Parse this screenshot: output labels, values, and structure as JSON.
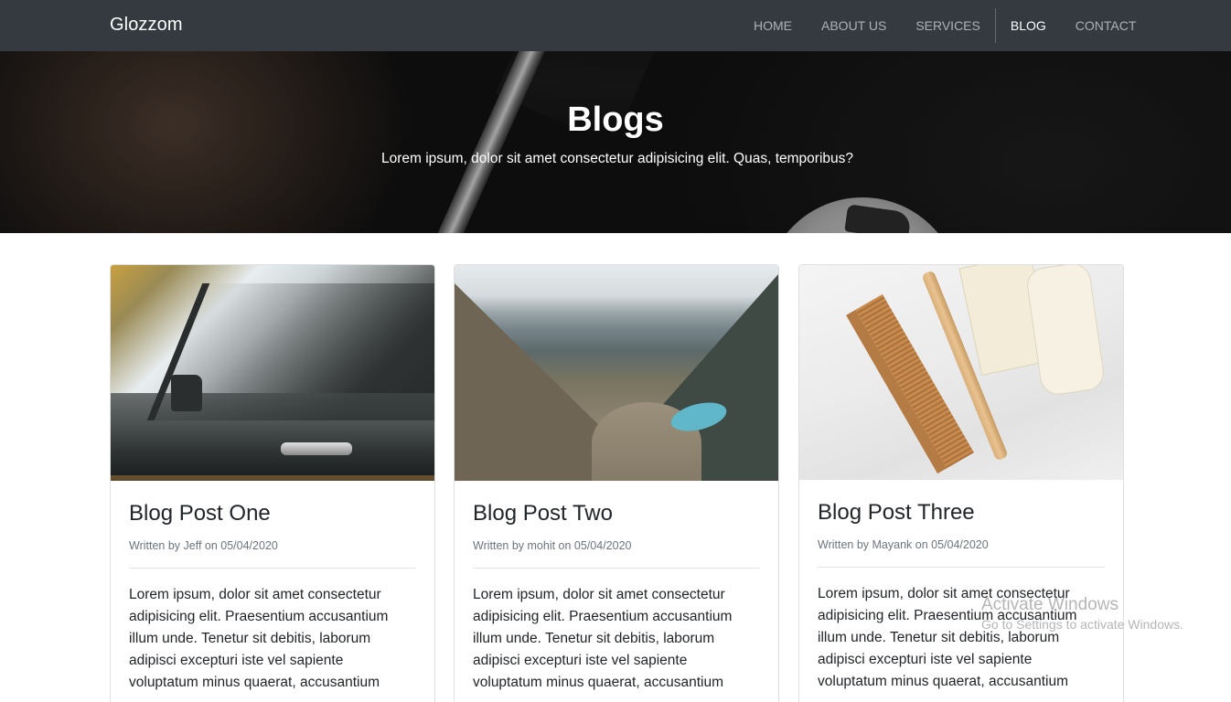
{
  "navbar": {
    "brand": "Glozzom",
    "links": [
      {
        "label": "HOME"
      },
      {
        "label": "ABOUT US"
      },
      {
        "label": "SERVICES"
      },
      {
        "label": "BLOG"
      },
      {
        "label": "CONTACT"
      }
    ],
    "active": "BLOG"
  },
  "hero": {
    "title": "Blogs",
    "subtitle": "Lorem ipsum, dolor sit amet consectetur adipisicing elit. Quas, temporibus?"
  },
  "posts": [
    {
      "title": "Blog Post One",
      "meta": "Written by Jeff on 05/04/2020",
      "text": "Lorem ipsum, dolor sit amet consectetur adipisicing elit. Praesentium accusantium illum unde. Tenetur sit debitis, laborum adipisci excepturi iste vel sapiente voluptatum minus quaerat, accusantium"
    },
    {
      "title": "Blog Post Two",
      "meta": "Written by mohit on 05/04/2020",
      "text": "Lorem ipsum, dolor sit amet consectetur adipisicing elit. Praesentium accusantium illum unde. Tenetur sit debitis, laborum adipisci excepturi iste vel sapiente voluptatum minus quaerat, accusantium"
    },
    {
      "title": "Blog Post Three",
      "meta": "Written by Mayank on 05/04/2020",
      "text": "Lorem ipsum, dolor sit amet consectetur adipisicing elit. Praesentium accusantium illum unde. Tenetur sit debitis, laborum adipisci excepturi iste vel sapiente voluptatum minus quaerat, accusantium"
    }
  ],
  "watermark": {
    "title": "Activate Windows",
    "subtitle": "Go to Settings to activate Windows."
  }
}
